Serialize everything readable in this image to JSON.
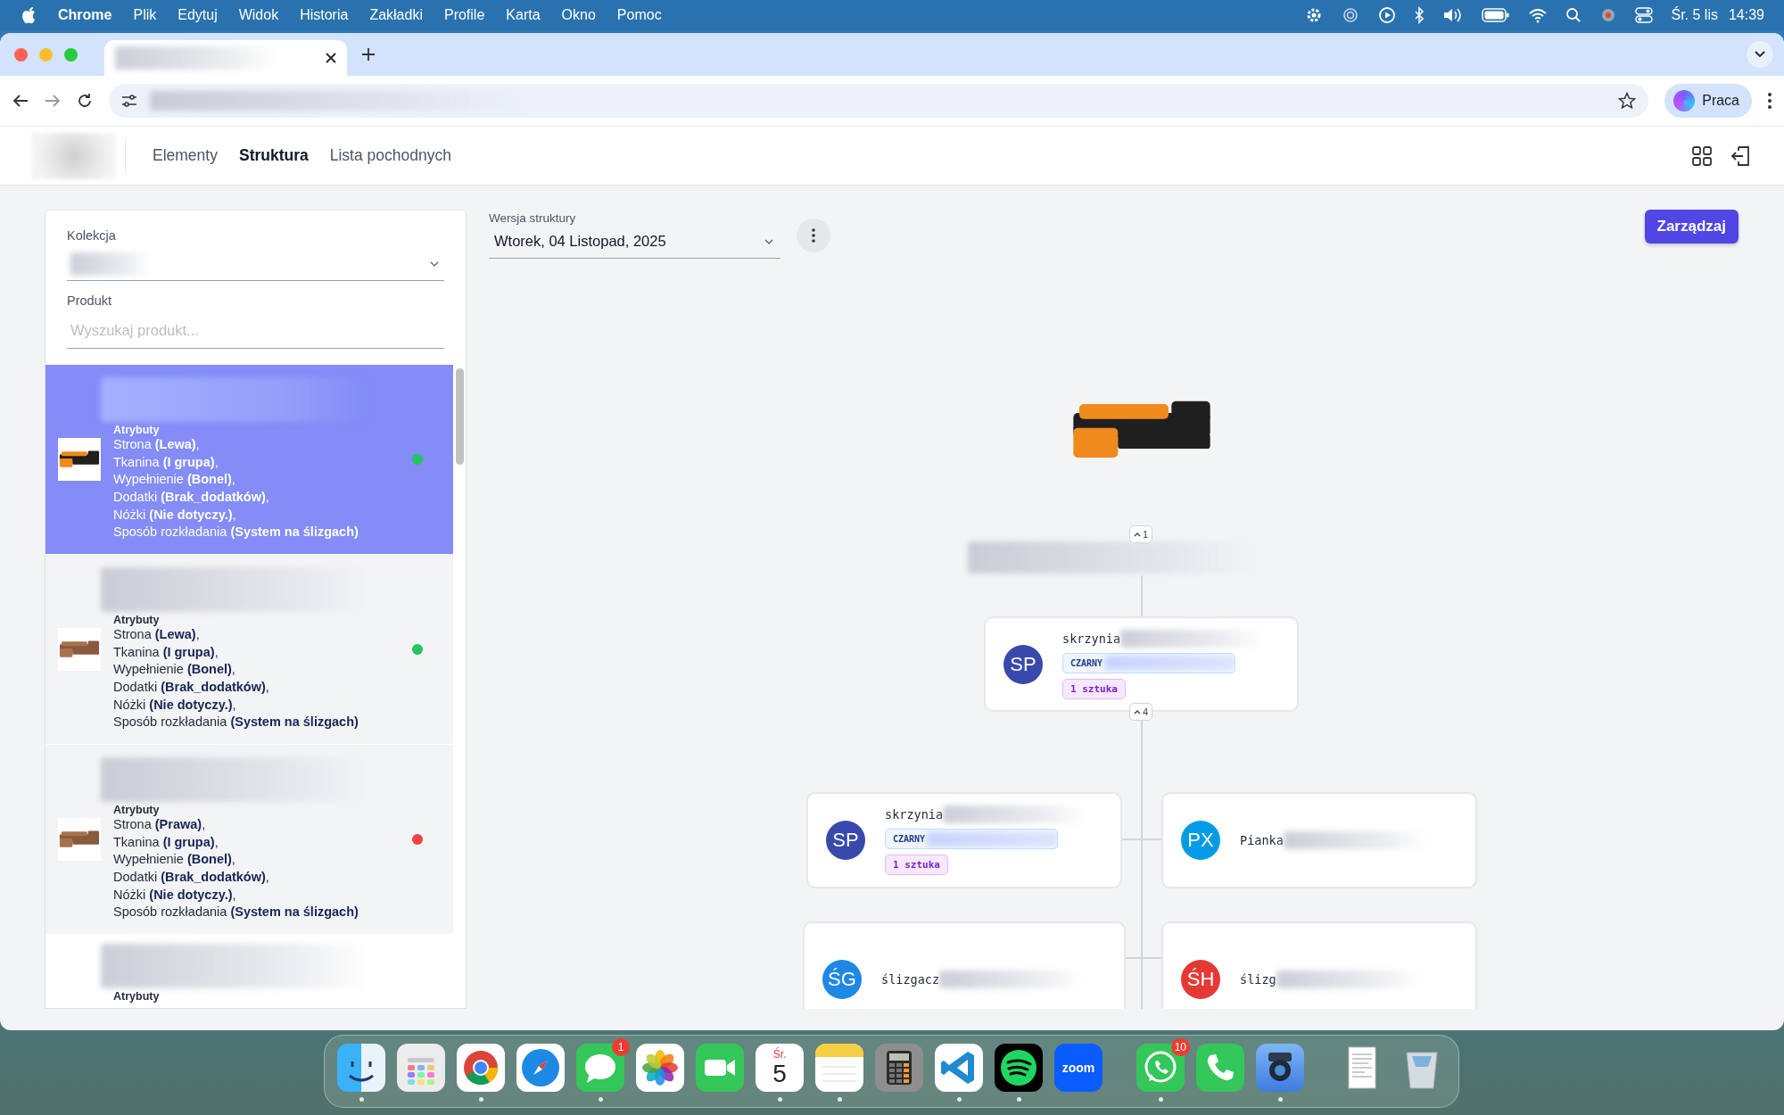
{
  "menu_bar": {
    "app_name": "Chrome",
    "items": [
      "Plik",
      "Edytuj",
      "Widok",
      "Historia",
      "Zakładki",
      "Profile",
      "Karta",
      "Okno",
      "Pomoc"
    ],
    "date": "Śr. 5 lis",
    "time": "14:39"
  },
  "browser": {
    "profile": "Praca"
  },
  "header": {
    "nav": [
      {
        "label": "Elementy",
        "selected": false
      },
      {
        "label": "Struktura",
        "selected": true
      },
      {
        "label": "Lista pochodnych",
        "selected": false
      }
    ]
  },
  "filters": {
    "collection_label": "Kolekcja",
    "product_label": "Produkt",
    "product_search": {
      "placeholder": "Wyszukaj produkt..."
    }
  },
  "products": [
    {
      "selected": true,
      "kind": "orange-sofa",
      "attributes_heading": "Atrybuty",
      "attributes": [
        "Strona **(Lewa)**,",
        "Tkanina **(I grupa)**,",
        "Wypełnienie **(Bonel)**,",
        "Dodatki **(Brak_dodatków)**,",
        "Nóżki **(Nie dotyczy.)**,",
        "Sposób rozkładania **(System na ślizgach)**"
      ],
      "color": "#22c55e"
    },
    {
      "selected": false,
      "kind": "brown-sofa",
      "attributes_heading": "Atrybuty",
      "attributes": [
        "Strona **(Lewa)**,",
        "Tkanina **(I grupa)**,",
        "Wypełnienie **(Bonel)**,",
        "Dodatki **(Brak_dodatków)**,",
        "Nóżki **(Nie dotyczy.)**,",
        "Sposób rozkładania **(System na ślizgach)**"
      ],
      "color": "#22c55e"
    },
    {
      "selected": false,
      "kind": "brown-sofa",
      "attributes_heading": "Atrybuty",
      "attributes": [
        "Strona **(Prawa)**,",
        "Tkanina **(I grupa)**,",
        "Wypełnienie **(Bonel)**,",
        "Dodatki **(Brak_dodatków)**,",
        "Nóżki **(Nie dotyczy.)**,",
        "Sposób rozkładania **(System na ślizgach)**"
      ],
      "color": "#ef4444"
    },
    {
      "selected": false,
      "attributes_heading": "Atrybuty"
    }
  ],
  "structure": {
    "version_label": "Wersja struktury",
    "version": "Wtorek, 04 Listopad, 2025",
    "manage_button": "Zarządzaj",
    "root": {
      "badge": "1",
      "expanded": true,
      "children": [
        {
          "initials": "SP",
          "color": "#3949ab",
          "name": "skrzynia",
          "tag": "CZARNY",
          "quantity": "1 sztuka",
          "badge": "4",
          "expanded": true,
          "children": [
            {
              "initials": "SP",
              "color": "#3949ab",
              "name": "skrzynia",
              "tag": "CZARNY",
              "quantity": "1 sztuka"
            },
            {
              "initials": "PX",
              "color": "#039be5",
              "name": "Pianka"
            },
            {
              "initials": "ŚG",
              "color": "#1e88e5",
              "name": "ślizgacz"
            },
            {
              "initials": "ŚH",
              "color": "#e53935",
              "name": "ślizg"
            }
          ]
        }
      ]
    }
  },
  "dock": [
    {
      "kind": "finder",
      "running": true
    },
    {
      "kind": "launchpad",
      "running": false
    },
    {
      "kind": "chrome",
      "running": true
    },
    {
      "kind": "safari",
      "running": false
    },
    {
      "kind": "messages",
      "running": true,
      "badge": "1"
    },
    {
      "kind": "photos",
      "running": false
    },
    {
      "kind": "facetime",
      "running": false
    },
    {
      "kind": "calendar",
      "running": true,
      "weekday": "Śr.",
      "day": "5"
    },
    {
      "kind": "notes",
      "running": true
    },
    {
      "kind": "calculator",
      "running": false
    },
    {
      "kind": "vscode",
      "running": true
    },
    {
      "kind": "spotify",
      "running": true
    },
    {
      "kind": "zoom",
      "running": false,
      "label": "zoom"
    },
    {
      "kind": "separator"
    },
    {
      "kind": "whatsapp",
      "running": true,
      "badge": "10"
    },
    {
      "kind": "phone",
      "running": false
    },
    {
      "kind": "magnifier",
      "running": true
    },
    {
      "kind": "separator"
    },
    {
      "kind": "document",
      "running": false
    },
    {
      "kind": "trash",
      "running": false
    }
  ]
}
